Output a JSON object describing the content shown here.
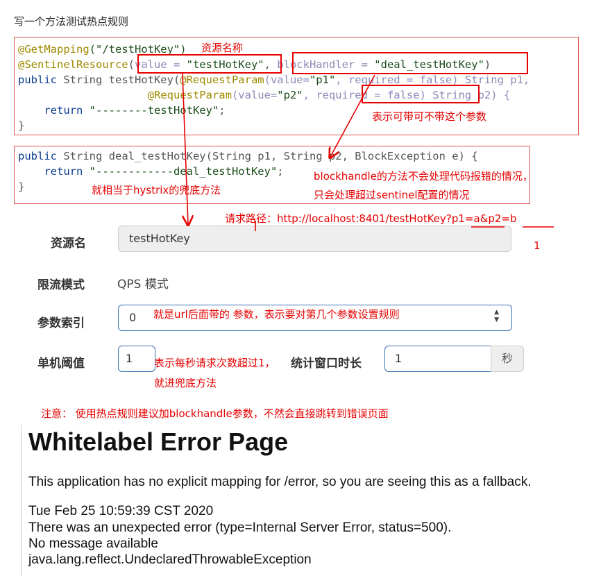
{
  "heading": "写一个方法测试热点规则",
  "code1": {
    "line1_annot": "@GetMapping",
    "line1_args": "(\"/testHotKey\")",
    "line2_annot": "@SentinelResource",
    "line2_open": "(",
    "line2_value_key": "value = ",
    "line2_value_str": "\"testHotKey\"",
    "line2_sep": ", ",
    "line2_block_key": "blockHandler = ",
    "line2_block_str": "\"deal_testHotKey\"",
    "line2_close": ")",
    "line3_kw": "public",
    "line3_rest": " String testHotKey(",
    "line3_annot": "@RequestParam",
    "line3_args_a": "(value=",
    "line3_str": "\"p1\"",
    "line3_args_b": ", required = false) String p1,",
    "line4_indent": "                    ",
    "line4_annot": "@RequestParam",
    "line4_args_a": "(value=",
    "line4_str": "\"p2\"",
    "line4_args_b": ", required = false) String p2) {",
    "line5_indent": "    ",
    "line5_kw": "return",
    "line5_str": " \"--------testHotKey\"",
    "line5_end": ";",
    "line6": "}"
  },
  "code2": {
    "line1_kw": "public",
    "line1_rest": " String deal_testHotKey(String p1, String p2, BlockException e) {",
    "line2_indent": "    ",
    "line2_kw": "return",
    "line2_str": " \"------------deal_testHotKey\"",
    "line2_end": ";",
    "line3": "}"
  },
  "notes": {
    "resource_name": "资源名称",
    "optional_param": "表示可带可不带这个参数",
    "blockhandler_1": "blockhandle的方法不会处理代码报错的情况，",
    "blockhandler_2": "只会处理超过sentinel配置的情况",
    "hystrix": "就相当于hystrix的兜底方法",
    "request_path": "请求路径：http://localhost:8401/testHotKey?p1=a&p2=b",
    "index_0": "0",
    "index_1": "1",
    "param_index_explain": "就是url后面带的 参数，表示要对第几个参数设置规则",
    "threshold_explain_1": "表示每秒请求次数超过1，",
    "threshold_explain_2": "就进兜底方法",
    "warning": "注意：  使用热点规则建议加blockhandle参数，不然会直接跳转到错误页面"
  },
  "form": {
    "resource_label": "资源名",
    "resource_value": "testHotKey",
    "mode_label": "限流模式",
    "mode_value": "QPS 模式",
    "param_index_label": "参数索引",
    "param_index_value": "0",
    "threshold_label": "单机阈值",
    "threshold_value": "1",
    "window_label": "统计窗口时长",
    "window_value": "1",
    "window_unit": "秒"
  },
  "error_page": {
    "title": "Whitelabel Error Page",
    "line1": "This application has no explicit mapping for /error, so you are seeing this as a fallback.",
    "line2": "Tue Feb 25 10:59:39 CST 2020",
    "line3": "There was an unexpected error (type=Internal Server Error, status=500).",
    "line4": "No message available",
    "line5": "java.lang.reflect.UndeclaredThrowableException"
  },
  "colors": {
    "annotation_red": "#e60000",
    "input_border": "#3a6fb0"
  },
  "icons": {
    "spinner": "spinner-updown-icon"
  }
}
